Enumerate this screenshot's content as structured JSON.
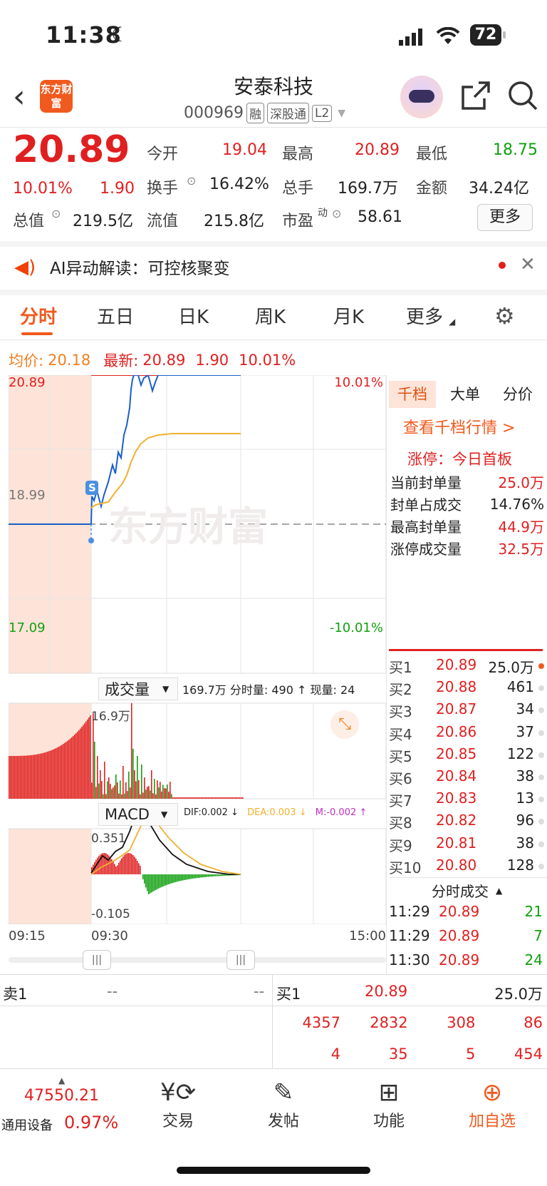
{
  "status": {
    "time": "11:38",
    "battery": "72"
  },
  "header": {
    "logo": "东方财富",
    "name": "安泰科技",
    "code": "000969",
    "tags": [
      "融",
      "深股通",
      "L2"
    ]
  },
  "quote": {
    "price": "20.89",
    "pct": "10.01%",
    "chg": "1.90",
    "open_label": "今开",
    "open": "19.04",
    "high_label": "最高",
    "high": "20.89",
    "low_label": "最低",
    "low": "18.75",
    "turnover_label": "换手",
    "turnover": "16.42%",
    "volume_label": "总手",
    "volume": "169.7万",
    "amount_label": "金额",
    "amount": "34.24亿",
    "mcap_label": "总值",
    "mcap": "219.5亿",
    "float_label": "流值",
    "float": "215.8亿",
    "pe_label": "市盈",
    "pe_sup": "动",
    "pe": "58.61",
    "more": "更多"
  },
  "ai_bar": {
    "text": "AI异动解读：可控核聚变"
  },
  "tabs": [
    "分时",
    "五日",
    "日K",
    "周K",
    "月K",
    "更多"
  ],
  "avg_row": {
    "avg_label": "均价:",
    "avg": "20.18",
    "last_label": "最新:",
    "last": "20.89",
    "chg": "1.90",
    "pct": "10.01%"
  },
  "chart": {
    "y_top": "20.89",
    "y_mid": "18.99",
    "y_bot": "17.09",
    "pct_top": "10.01%",
    "pct_bot": "-10.01%",
    "watermark": "东方财富",
    "s_mark": "S",
    "vol_selector": "成交量",
    "vol_info": "169.7万 分时量: 490 ↑ 现量: 24",
    "vol_max": "16.9万",
    "macd_selector": "MACD",
    "dif": "DIF:0.002 ↓",
    "dea": "DEA:0.003 ↓",
    "m": "M:-0.002 ↑",
    "macd_max": "0.351",
    "macd_min": "-0.105",
    "times": [
      "09:15",
      "09:30",
      "15:00"
    ],
    "colors": {
      "price": "#1a5fc8",
      "avg": "#f0b030",
      "up": "#e02020",
      "down": "#10a010",
      "premarket": "#fde3d8"
    }
  },
  "right_panel": {
    "tabs": [
      "千档",
      "大单",
      "分价"
    ],
    "link": "查看千档行情 >",
    "limit_title": "涨停：今日首板",
    "stats": [
      {
        "label": "当前封单量",
        "value": "25.0万"
      },
      {
        "label": "封单占成交",
        "value": "14.76%"
      },
      {
        "label": "最高封单量",
        "value": "44.9万"
      },
      {
        "label": "涨停成交量",
        "value": "32.5万"
      }
    ],
    "bids": [
      {
        "label": "买1",
        "price": "20.89",
        "vol": "25.0万"
      },
      {
        "label": "买2",
        "price": "20.88",
        "vol": "461"
      },
      {
        "label": "买3",
        "price": "20.87",
        "vol": "34"
      },
      {
        "label": "买4",
        "price": "20.86",
        "vol": "37"
      },
      {
        "label": "买5",
        "price": "20.85",
        "vol": "122"
      },
      {
        "label": "买6",
        "price": "20.84",
        "vol": "38"
      },
      {
        "label": "买7",
        "price": "20.83",
        "vol": "13"
      },
      {
        "label": "买8",
        "price": "20.82",
        "vol": "96"
      },
      {
        "label": "买9",
        "price": "20.81",
        "vol": "38"
      },
      {
        "label": "买10",
        "price": "20.80",
        "vol": "128"
      }
    ],
    "trades_title": "分时成交",
    "trades": [
      {
        "time": "11:29",
        "price": "20.89",
        "vol": "21"
      },
      {
        "time": "11:29",
        "price": "20.89",
        "vol": "7"
      },
      {
        "time": "11:30",
        "price": "20.89",
        "vol": "24"
      }
    ]
  },
  "bottom_book": {
    "ask_label": "卖1",
    "ask_price": "--",
    "ask_vol": "--",
    "bid_label": "买1",
    "bid_price": "20.89",
    "bid_vol": "25.0万",
    "queue1": [
      "4357",
      "2832",
      "308",
      "86"
    ],
    "queue2": [
      "4",
      "35",
      "5",
      "454"
    ]
  },
  "nav": {
    "index_value": "47550.21",
    "index_name": "通用设备",
    "index_pct": "0.97%",
    "trade": "交易",
    "post": "发帖",
    "func": "功能",
    "add": "加自选"
  }
}
